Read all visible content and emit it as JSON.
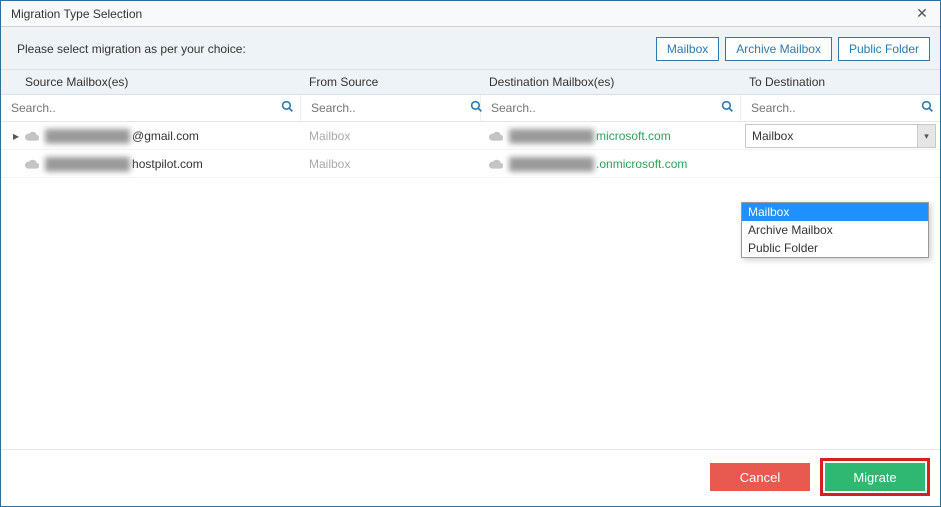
{
  "window": {
    "title": "Migration Type Selection"
  },
  "toolbar": {
    "label": "Please select migration as per your choice:",
    "buttons": {
      "mailbox": "Mailbox",
      "archive": "Archive Mailbox",
      "public_folder": "Public Folder"
    }
  },
  "columns": {
    "source": "Source Mailbox(es)",
    "from_source": "From Source",
    "destination": "Destination Mailbox(es)",
    "to_destination": "To Destination"
  },
  "search": {
    "placeholder": "Search.."
  },
  "rows": [
    {
      "source_prefix": "██████████",
      "source_domain": "@gmail.com",
      "from_source": "Mailbox",
      "dest_prefix": "██████████",
      "dest_domain": "microsoft.com",
      "dest_domain_color_green": true,
      "to_destination_selected": "Mailbox",
      "expandable": true
    },
    {
      "source_prefix": "██████████",
      "source_domain": "hostpilot.com",
      "from_source": "Mailbox",
      "dest_prefix": "██████████",
      "dest_domain": ".onmicrosoft.com",
      "dest_domain_color_green": true,
      "to_destination_selected": "",
      "expandable": false
    }
  ],
  "dropdown": {
    "items": [
      "Mailbox",
      "Archive Mailbox",
      "Public Folder"
    ],
    "selected_index": 0
  },
  "footer": {
    "cancel": "Cancel",
    "migrate": "Migrate"
  }
}
